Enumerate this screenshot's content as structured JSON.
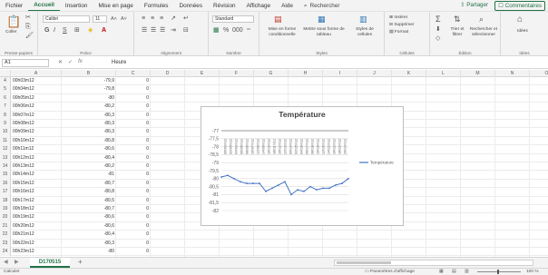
{
  "menu": {
    "items": [
      "Fichier",
      "Accueil",
      "Insertion",
      "Mise en page",
      "Formules",
      "Données",
      "Révision",
      "Affichage",
      "Aide"
    ],
    "active": "Accueil",
    "tell_me": "Rechercher",
    "share": "Partager",
    "comments": "Commentaires"
  },
  "ribbon": {
    "clipboard": {
      "paste": "Coller",
      "label": "Presse-papiers"
    },
    "font": {
      "name": "Calibri",
      "size": "11",
      "bold": "G",
      "italic": "I",
      "underline": "S",
      "label": "Police"
    },
    "alignment": {
      "label": "Alignement"
    },
    "number": {
      "format": "Standard",
      "label": "Nombre"
    },
    "styles": {
      "conditional": "Mise en forme conditionnelle",
      "table": "Mettre sous forme de tableau",
      "cell_styles": "Styles de cellules",
      "label": "Styles"
    },
    "cells": {
      "insert": "Insérer",
      "delete": "Supprimer",
      "format": "Format",
      "label": "Cellules"
    },
    "editing": {
      "sort": "Trier et filtrer",
      "find": "Rechercher et sélectionner",
      "label": "Édition"
    },
    "ideas": {
      "button": "Idées",
      "label": "Idées"
    }
  },
  "formula_bar": {
    "name_box": "A1",
    "formula": "Heure"
  },
  "columns": [
    "A",
    "B",
    "C",
    "D",
    "E",
    "F",
    "G",
    "H",
    "I",
    "J",
    "K",
    "L",
    "M",
    "N",
    "O",
    "P"
  ],
  "rows": [
    {
      "n": "4",
      "a": "00h03m12",
      "b": "-79,9",
      "c": "0"
    },
    {
      "n": "5",
      "a": "00h04m12",
      "b": "-79,8",
      "c": "0"
    },
    {
      "n": "6",
      "a": "00h05m12",
      "b": "-80",
      "c": "0"
    },
    {
      "n": "7",
      "a": "00h06m12",
      "b": "-80,2",
      "c": "0"
    },
    {
      "n": "8",
      "a": "00h07m12",
      "b": "-80,3",
      "c": "0"
    },
    {
      "n": "9",
      "a": "00h08m12",
      "b": "-80,3",
      "c": "0"
    },
    {
      "n": "10",
      "a": "00h09m12",
      "b": "-80,3",
      "c": "0"
    },
    {
      "n": "11",
      "a": "00h10m12",
      "b": "-80,8",
      "c": "0"
    },
    {
      "n": "12",
      "a": "00h11m12",
      "b": "-80,6",
      "c": "0"
    },
    {
      "n": "13",
      "a": "00h12m12",
      "b": "-80,4",
      "c": "0"
    },
    {
      "n": "14",
      "a": "00h13m12",
      "b": "-80,2",
      "c": "0"
    },
    {
      "n": "15",
      "a": "00h14m12",
      "b": "-81",
      "c": "0"
    },
    {
      "n": "16",
      "a": "00h15m12",
      "b": "-80,7",
      "c": "0"
    },
    {
      "n": "17",
      "a": "00h16m12",
      "b": "-80,8",
      "c": "0"
    },
    {
      "n": "18",
      "a": "00h17m12",
      "b": "-80,5",
      "c": "0"
    },
    {
      "n": "19",
      "a": "00h18m12",
      "b": "-80,7",
      "c": "0"
    },
    {
      "n": "20",
      "a": "00h19m12",
      "b": "-80,6",
      "c": "0"
    },
    {
      "n": "21",
      "a": "00h20m12",
      "b": "-80,6",
      "c": "0"
    },
    {
      "n": "22",
      "a": "00h21m12",
      "b": "-80,4",
      "c": "0"
    },
    {
      "n": "23",
      "a": "00h22m12",
      "b": "-80,3",
      "c": "0"
    },
    {
      "n": "24",
      "a": "00h23m12",
      "b": "-80",
      "c": "0"
    }
  ],
  "chart": {
    "title": "Température",
    "legend": "Température",
    "y_ticks": [
      "-77",
      "-77,5",
      "-78",
      "-78,5",
      "-79",
      "-79,5",
      "-80",
      "-80,5",
      "-81",
      "-81,5",
      "-82"
    ],
    "x_ticks": [
      "00h03m12",
      "02h05m12",
      "04h03m12",
      "06h05m12",
      "08h06m12",
      "10h07m12",
      "12h06m12",
      "14h09m12",
      "16h10m12",
      "18h11m12",
      "20h12m12",
      "22h13m12",
      "00h14m12",
      "02h15m12",
      "04h16m12",
      "06h17m12",
      "08h18m12",
      "10h19m12",
      "12h20m12",
      "14h21m12",
      "16h22m12",
      "18h23m12",
      "20h24m12"
    ]
  },
  "chart_data": {
    "type": "line",
    "title": "Température",
    "xlabel": "",
    "ylabel": "",
    "ylim": [
      -82,
      -77
    ],
    "reversed_y_axis": true,
    "legend": "right",
    "series": [
      {
        "name": "Température",
        "color": "#4472c4",
        "values": [
          -79.9,
          -79.8,
          -80,
          -80.2,
          -80.3,
          -80.3,
          -80.3,
          -80.8,
          -80.6,
          -80.4,
          -80.2,
          -81,
          -80.7,
          -80.8,
          -80.5,
          -80.7,
          -80.6,
          -80.6,
          -80.4,
          -80.3,
          -80
        ]
      }
    ]
  },
  "sheet": {
    "tab": "D170515",
    "add": "+"
  },
  "status": {
    "left": "Calculer",
    "display_settings": "Paramètres d'affichage",
    "zoom": "100 %"
  }
}
